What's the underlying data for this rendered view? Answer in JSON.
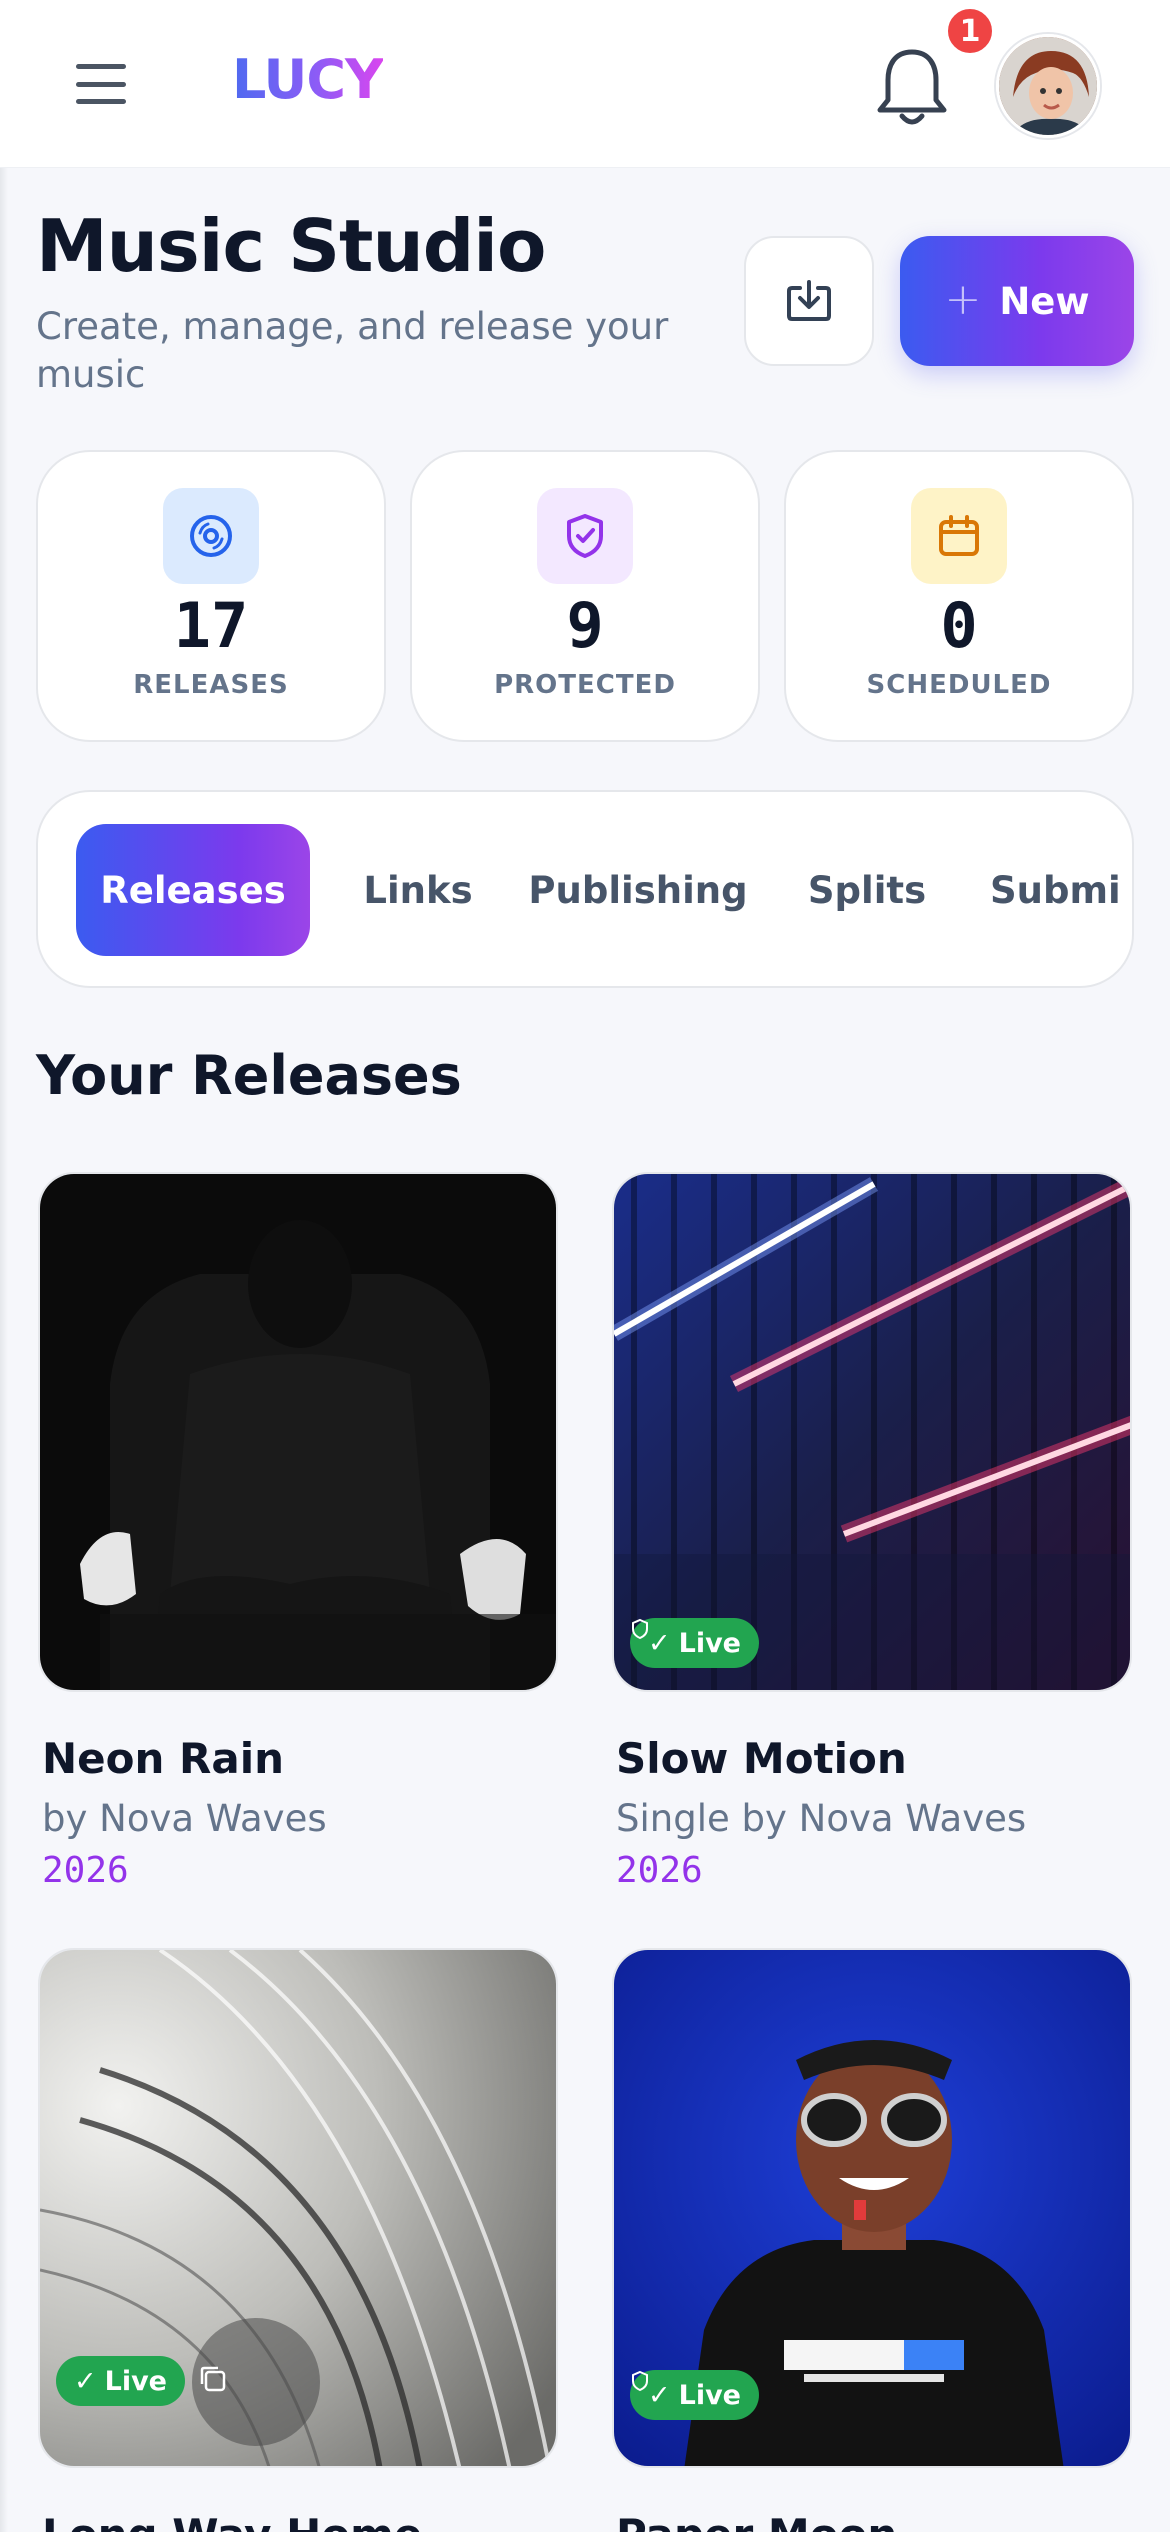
{
  "app": {
    "logo": "LUCY",
    "notification_count": "1"
  },
  "header": {
    "title": "Music Studio",
    "subtitle": "Create, manage, and release your music",
    "new_button_label": "New"
  },
  "stats": [
    {
      "value": "17",
      "label": "RELEASES",
      "icon": "disc-icon",
      "color": "#2563eb",
      "bg": "#dbeafe"
    },
    {
      "value": "9",
      "label": "PROTECTED",
      "icon": "shield-check-icon",
      "color": "#9333ea",
      "bg": "#f3e8ff"
    },
    {
      "value": "0",
      "label": "SCHEDULED",
      "icon": "calendar-icon",
      "color": "#d97706",
      "bg": "#fef3c7"
    }
  ],
  "tabs": [
    {
      "label": "Releases",
      "active": true
    },
    {
      "label": "Links"
    },
    {
      "label": "Publishing"
    },
    {
      "label": "Splits"
    },
    {
      "label": "Submi"
    }
  ],
  "releases_section": {
    "title": "Your Releases",
    "items": [
      {
        "title": "Neon Rain",
        "meta": "by Nova Waves",
        "year": "2026",
        "badge": ""
      },
      {
        "title": "Slow Motion",
        "meta": "Single by Nova Waves",
        "year": "2026",
        "badge": "Live"
      },
      {
        "title": "Long Way Home",
        "meta": "",
        "year": "",
        "badge": "Live"
      },
      {
        "title": "Paper Moon",
        "meta": "",
        "year": "",
        "badge": "Live"
      }
    ]
  },
  "colors": {
    "accent_start": "#3b5bf0",
    "accent_end": "#9b45e8",
    "live_green": "#22a550",
    "year_purple": "#9333ea"
  }
}
